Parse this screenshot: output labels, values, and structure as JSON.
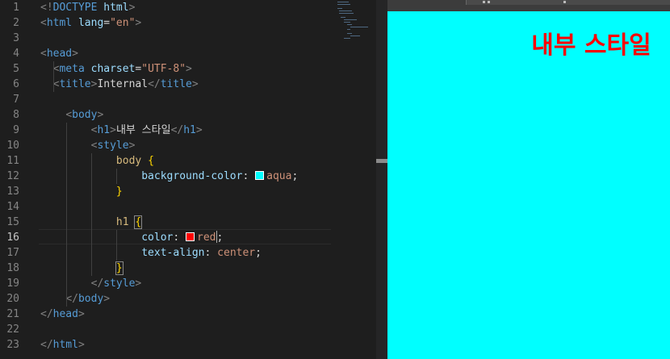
{
  "editor": {
    "active_line": 16,
    "lines": [
      {
        "n": "1",
        "tokens": [
          [
            "t-punc",
            "<!"
          ],
          [
            "t-tag",
            "DOCTYPE "
          ],
          [
            "t-attr",
            "html"
          ],
          [
            "t-punc",
            ">"
          ]
        ]
      },
      {
        "n": "2",
        "tokens": [
          [
            "t-punc",
            "<"
          ],
          [
            "t-tag",
            "html "
          ],
          [
            "t-attr",
            "lang"
          ],
          [
            "t-text",
            "="
          ],
          [
            "t-str",
            "\"en\""
          ],
          [
            "t-punc",
            ">"
          ]
        ]
      },
      {
        "n": "3",
        "tokens": []
      },
      {
        "n": "4",
        "tokens": [
          [
            "t-punc",
            "<"
          ],
          [
            "t-tag",
            "head"
          ],
          [
            "t-punc",
            ">"
          ]
        ]
      },
      {
        "n": "5",
        "tokens": [
          [
            "t-text",
            "  "
          ],
          [
            "t-punc",
            "<"
          ],
          [
            "t-tag",
            "meta "
          ],
          [
            "t-attr",
            "charset"
          ],
          [
            "t-text",
            "="
          ],
          [
            "t-str",
            "\"UTF-8\""
          ],
          [
            "t-punc",
            ">"
          ]
        ]
      },
      {
        "n": "6",
        "tokens": [
          [
            "t-text",
            "  "
          ],
          [
            "t-punc",
            "<"
          ],
          [
            "t-tag",
            "title"
          ],
          [
            "t-punc",
            ">"
          ],
          [
            "t-text",
            "Internal"
          ],
          [
            "t-punc",
            "</"
          ],
          [
            "t-tag",
            "title"
          ],
          [
            "t-punc",
            ">"
          ]
        ]
      },
      {
        "n": "7",
        "tokens": []
      },
      {
        "n": "8",
        "tokens": [
          [
            "t-text",
            "    "
          ],
          [
            "t-punc",
            "<"
          ],
          [
            "t-tag",
            "body"
          ],
          [
            "t-punc",
            ">"
          ]
        ]
      },
      {
        "n": "9",
        "tokens": [
          [
            "t-text",
            "        "
          ],
          [
            "t-punc",
            "<"
          ],
          [
            "t-tag",
            "h1"
          ],
          [
            "t-punc",
            ">"
          ],
          [
            "t-text",
            "내부 스타일"
          ],
          [
            "t-punc",
            "</"
          ],
          [
            "t-tag",
            "h1"
          ],
          [
            "t-punc",
            ">"
          ]
        ]
      },
      {
        "n": "10",
        "tokens": [
          [
            "t-text",
            "        "
          ],
          [
            "t-punc",
            "<"
          ],
          [
            "t-tag",
            "style"
          ],
          [
            "t-punc",
            ">"
          ]
        ]
      },
      {
        "n": "11",
        "tokens": [
          [
            "t-text",
            "            "
          ],
          [
            "t-sel",
            "body "
          ],
          [
            "t-brace",
            "{"
          ]
        ]
      },
      {
        "n": "12",
        "tokens": [
          [
            "t-text",
            "                "
          ],
          [
            "t-prop",
            "background-color"
          ],
          [
            "t-text",
            ": "
          ],
          [
            "swatch",
            "#00ffff"
          ],
          [
            "t-val",
            "aqua"
          ],
          [
            "t-text",
            ";"
          ]
        ]
      },
      {
        "n": "13",
        "tokens": [
          [
            "t-text",
            "            "
          ],
          [
            "t-brace",
            "}"
          ]
        ]
      },
      {
        "n": "14",
        "tokens": []
      },
      {
        "n": "15",
        "tokens": [
          [
            "t-text",
            "            "
          ],
          [
            "t-sel",
            "h1 "
          ],
          [
            "t-brace-match",
            "{"
          ]
        ]
      },
      {
        "n": "16",
        "tokens": [
          [
            "t-text",
            "                "
          ],
          [
            "t-prop",
            "color"
          ],
          [
            "t-text",
            ": "
          ],
          [
            "swatch",
            "#ff0000"
          ],
          [
            "t-val",
            "red"
          ],
          [
            "cursor",
            ""
          ],
          [
            "t-text",
            ";"
          ]
        ]
      },
      {
        "n": "17",
        "tokens": [
          [
            "t-text",
            "                "
          ],
          [
            "t-prop",
            "text-align"
          ],
          [
            "t-text",
            ": "
          ],
          [
            "t-val",
            "center"
          ],
          [
            "t-text",
            ";"
          ]
        ]
      },
      {
        "n": "18",
        "tokens": [
          [
            "t-text",
            "            "
          ],
          [
            "t-brace-match",
            "}"
          ]
        ]
      },
      {
        "n": "19",
        "tokens": [
          [
            "t-text",
            "        "
          ],
          [
            "t-punc",
            "</"
          ],
          [
            "t-tag",
            "style"
          ],
          [
            "t-punc",
            ">"
          ]
        ]
      },
      {
        "n": "20",
        "tokens": [
          [
            "t-text",
            "    "
          ],
          [
            "t-punc",
            "</"
          ],
          [
            "t-tag",
            "body"
          ],
          [
            "t-punc",
            ">"
          ]
        ]
      },
      {
        "n": "21",
        "tokens": [
          [
            "t-punc",
            "</"
          ],
          [
            "t-tag",
            "head"
          ],
          [
            "t-punc",
            ">"
          ]
        ]
      },
      {
        "n": "22",
        "tokens": []
      },
      {
        "n": "23",
        "tokens": [
          [
            "t-punc",
            "</"
          ],
          [
            "t-tag",
            "html"
          ],
          [
            "t-punc",
            ">"
          ]
        ]
      }
    ]
  },
  "preview": {
    "background_color": "#00ffff",
    "heading": "내부 스타일",
    "heading_color": "#ff0000"
  }
}
